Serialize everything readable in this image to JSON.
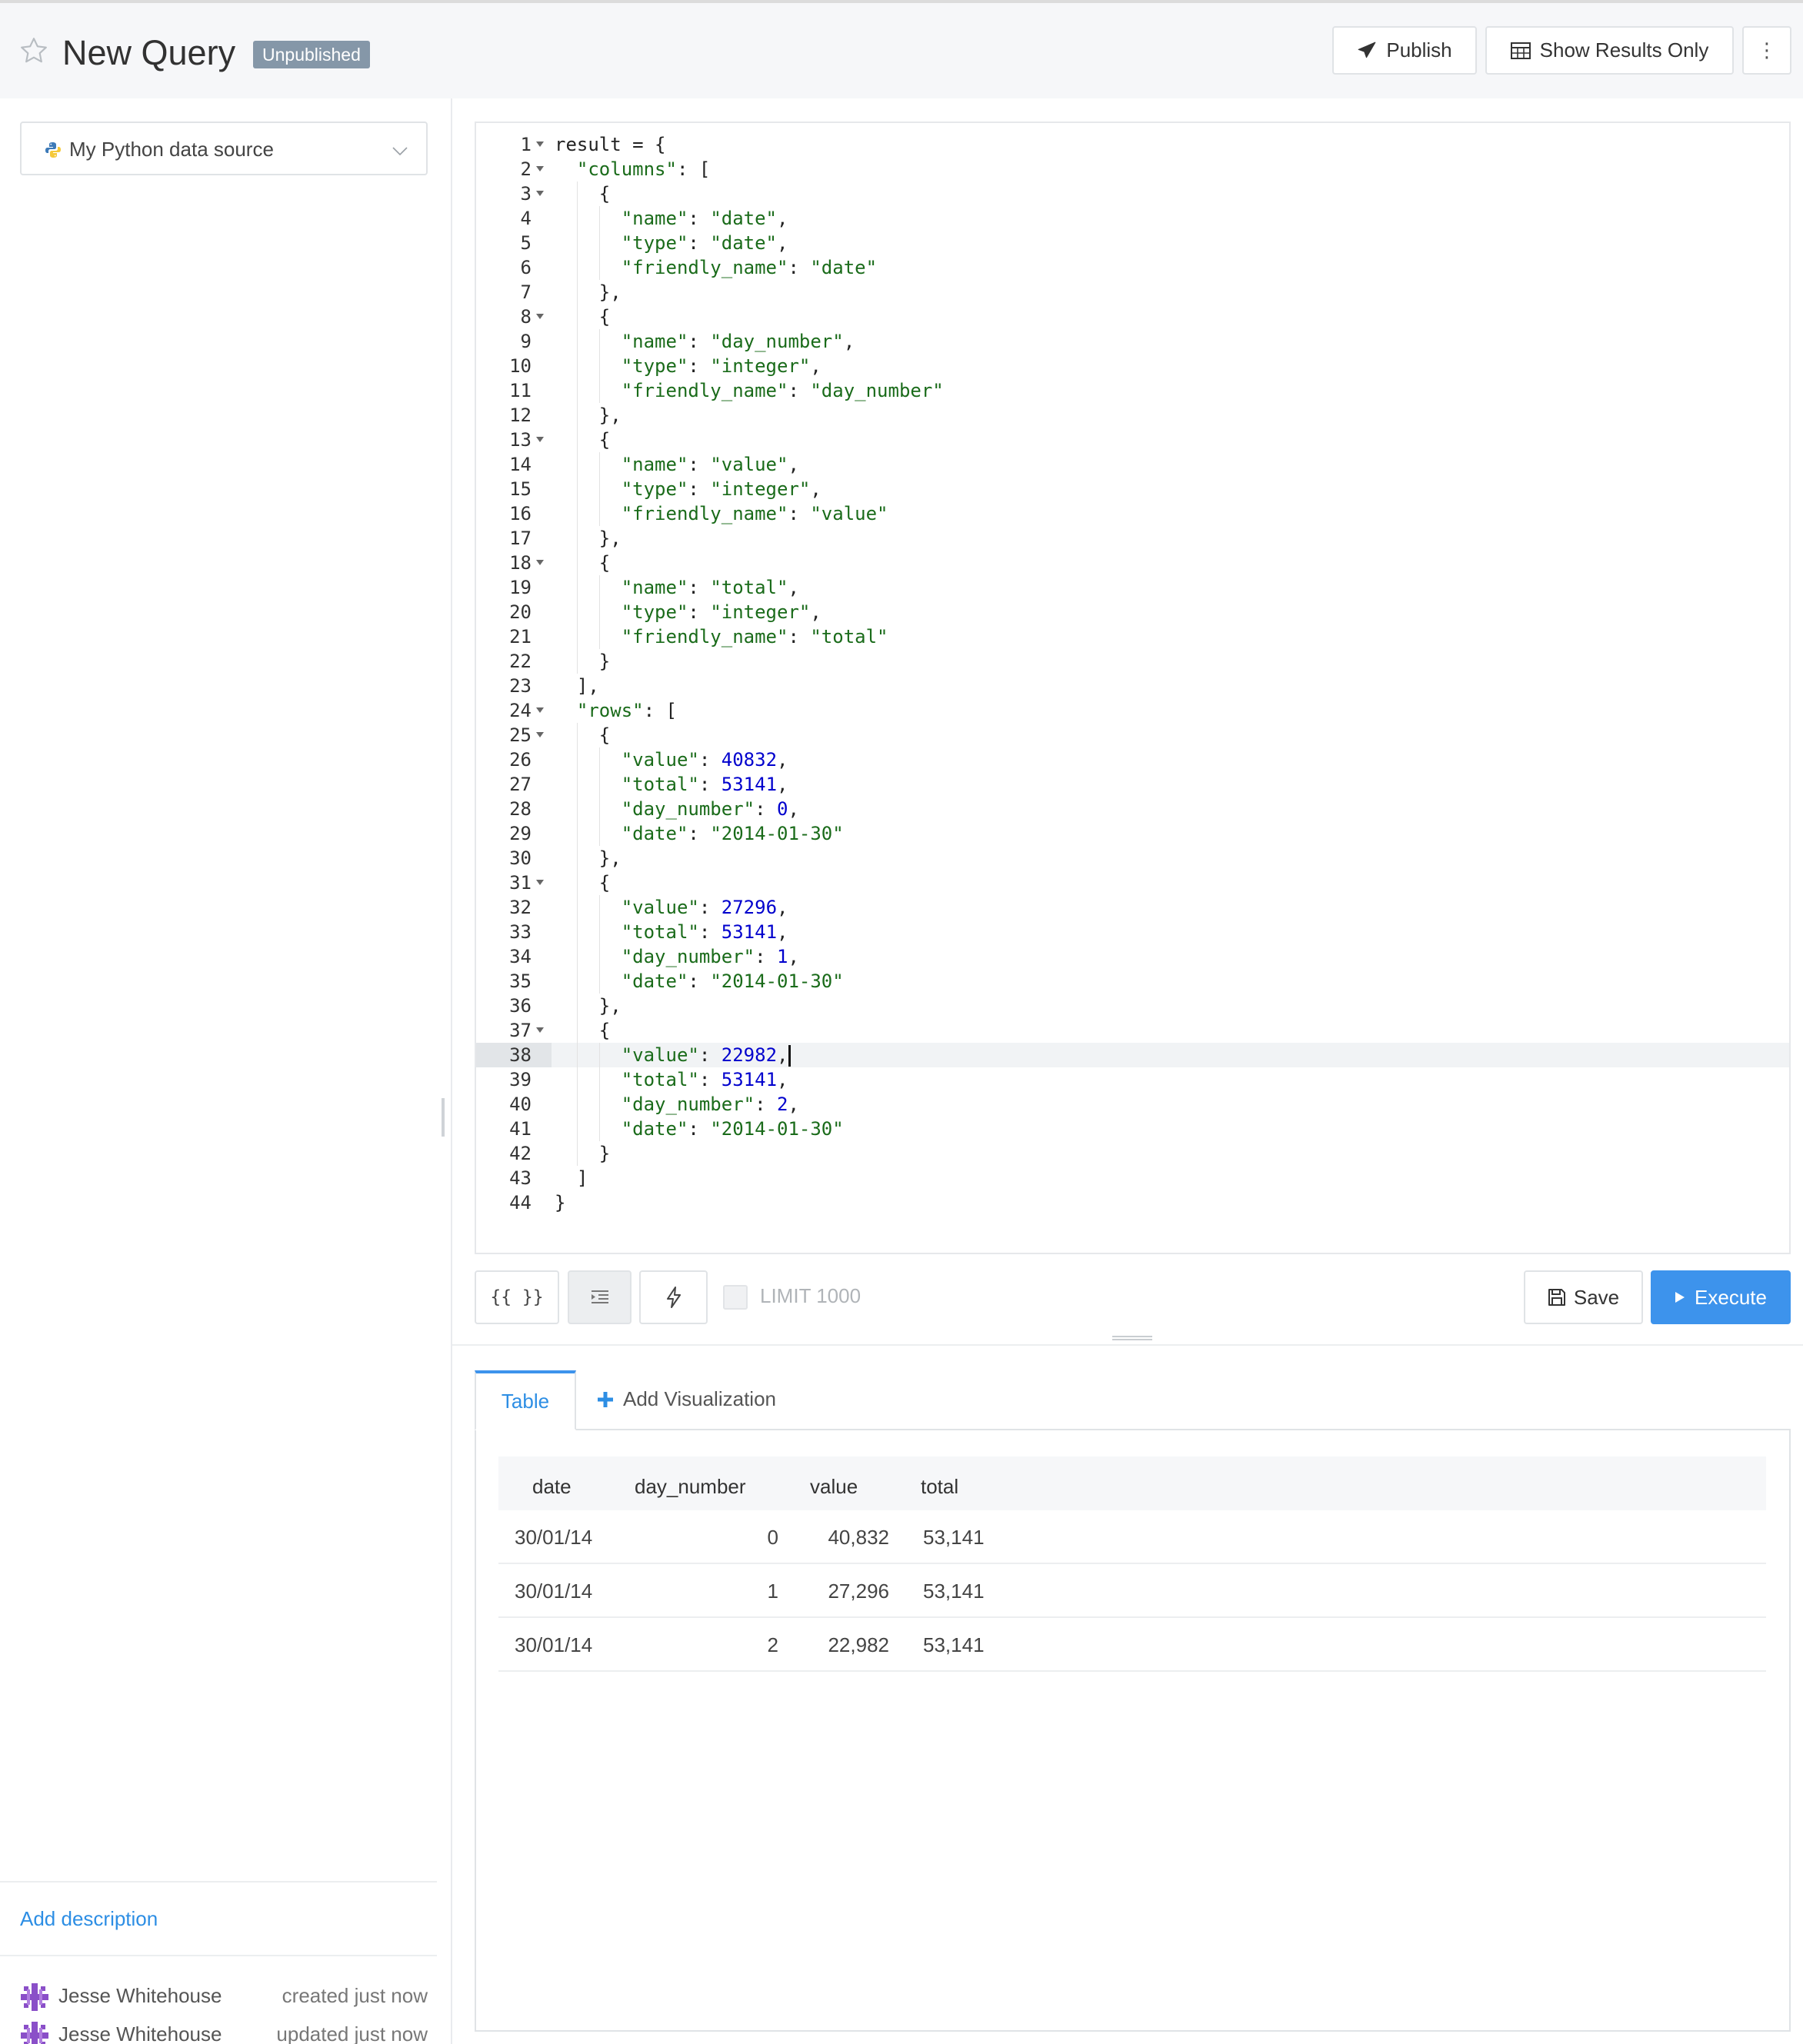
{
  "header": {
    "title": "New Query",
    "status_badge": "Unpublished",
    "publish_label": "Publish",
    "show_results_label": "Show Results Only",
    "more_label": "⋮"
  },
  "sidebar": {
    "data_source": "My Python data source",
    "add_description": "Add description",
    "users": [
      {
        "name": "Jesse Whitehouse",
        "status": "created just now"
      },
      {
        "name": "Jesse Whitehouse",
        "status": "updated just now"
      }
    ]
  },
  "editor": {
    "active_line": 38,
    "lines": [
      [
        [
          "p",
          "result = {"
        ]
      ],
      [
        [
          "p",
          "  "
        ],
        [
          "k",
          "\"columns\""
        ],
        [
          "p",
          ": ["
        ]
      ],
      [
        [
          "p",
          "    {"
        ]
      ],
      [
        [
          "p",
          "      "
        ],
        [
          "k",
          "\"name\""
        ],
        [
          "p",
          ": "
        ],
        [
          "s",
          "\"date\""
        ],
        [
          "p",
          ","
        ]
      ],
      [
        [
          "p",
          "      "
        ],
        [
          "k",
          "\"type\""
        ],
        [
          "p",
          ": "
        ],
        [
          "s",
          "\"date\""
        ],
        [
          "p",
          ","
        ]
      ],
      [
        [
          "p",
          "      "
        ],
        [
          "k",
          "\"friendly_name\""
        ],
        [
          "p",
          ": "
        ],
        [
          "s",
          "\"date\""
        ]
      ],
      [
        [
          "p",
          "    },"
        ]
      ],
      [
        [
          "p",
          "    {"
        ]
      ],
      [
        [
          "p",
          "      "
        ],
        [
          "k",
          "\"name\""
        ],
        [
          "p",
          ": "
        ],
        [
          "s",
          "\"day_number\""
        ],
        [
          "p",
          ","
        ]
      ],
      [
        [
          "p",
          "      "
        ],
        [
          "k",
          "\"type\""
        ],
        [
          "p",
          ": "
        ],
        [
          "s",
          "\"integer\""
        ],
        [
          "p",
          ","
        ]
      ],
      [
        [
          "p",
          "      "
        ],
        [
          "k",
          "\"friendly_name\""
        ],
        [
          "p",
          ": "
        ],
        [
          "s",
          "\"day_number\""
        ]
      ],
      [
        [
          "p",
          "    },"
        ]
      ],
      [
        [
          "p",
          "    {"
        ]
      ],
      [
        [
          "p",
          "      "
        ],
        [
          "k",
          "\"name\""
        ],
        [
          "p",
          ": "
        ],
        [
          "s",
          "\"value\""
        ],
        [
          "p",
          ","
        ]
      ],
      [
        [
          "p",
          "      "
        ],
        [
          "k",
          "\"type\""
        ],
        [
          "p",
          ": "
        ],
        [
          "s",
          "\"integer\""
        ],
        [
          "p",
          ","
        ]
      ],
      [
        [
          "p",
          "      "
        ],
        [
          "k",
          "\"friendly_name\""
        ],
        [
          "p",
          ": "
        ],
        [
          "s",
          "\"value\""
        ]
      ],
      [
        [
          "p",
          "    },"
        ]
      ],
      [
        [
          "p",
          "    {"
        ]
      ],
      [
        [
          "p",
          "      "
        ],
        [
          "k",
          "\"name\""
        ],
        [
          "p",
          ": "
        ],
        [
          "s",
          "\"total\""
        ],
        [
          "p",
          ","
        ]
      ],
      [
        [
          "p",
          "      "
        ],
        [
          "k",
          "\"type\""
        ],
        [
          "p",
          ": "
        ],
        [
          "s",
          "\"integer\""
        ],
        [
          "p",
          ","
        ]
      ],
      [
        [
          "p",
          "      "
        ],
        [
          "k",
          "\"friendly_name\""
        ],
        [
          "p",
          ": "
        ],
        [
          "s",
          "\"total\""
        ]
      ],
      [
        [
          "p",
          "    }"
        ]
      ],
      [
        [
          "p",
          "  ],"
        ]
      ],
      [
        [
          "p",
          "  "
        ],
        [
          "k",
          "\"rows\""
        ],
        [
          "p",
          ": ["
        ]
      ],
      [
        [
          "p",
          "    {"
        ]
      ],
      [
        [
          "p",
          "      "
        ],
        [
          "k",
          "\"value\""
        ],
        [
          "p",
          ": "
        ],
        [
          "n",
          "40832"
        ],
        [
          "p",
          ","
        ]
      ],
      [
        [
          "p",
          "      "
        ],
        [
          "k",
          "\"total\""
        ],
        [
          "p",
          ": "
        ],
        [
          "n",
          "53141"
        ],
        [
          "p",
          ","
        ]
      ],
      [
        [
          "p",
          "      "
        ],
        [
          "k",
          "\"day_number\""
        ],
        [
          "p",
          ": "
        ],
        [
          "n",
          "0"
        ],
        [
          "p",
          ","
        ]
      ],
      [
        [
          "p",
          "      "
        ],
        [
          "k",
          "\"date\""
        ],
        [
          "p",
          ": "
        ],
        [
          "s",
          "\"2014-01-30\""
        ]
      ],
      [
        [
          "p",
          "    },"
        ]
      ],
      [
        [
          "p",
          "    {"
        ]
      ],
      [
        [
          "p",
          "      "
        ],
        [
          "k",
          "\"value\""
        ],
        [
          "p",
          ": "
        ],
        [
          "n",
          "27296"
        ],
        [
          "p",
          ","
        ]
      ],
      [
        [
          "p",
          "      "
        ],
        [
          "k",
          "\"total\""
        ],
        [
          "p",
          ": "
        ],
        [
          "n",
          "53141"
        ],
        [
          "p",
          ","
        ]
      ],
      [
        [
          "p",
          "      "
        ],
        [
          "k",
          "\"day_number\""
        ],
        [
          "p",
          ": "
        ],
        [
          "n",
          "1"
        ],
        [
          "p",
          ","
        ]
      ],
      [
        [
          "p",
          "      "
        ],
        [
          "k",
          "\"date\""
        ],
        [
          "p",
          ": "
        ],
        [
          "s",
          "\"2014-01-30\""
        ]
      ],
      [
        [
          "p",
          "    },"
        ]
      ],
      [
        [
          "p",
          "    {"
        ]
      ],
      [
        [
          "p",
          "      "
        ],
        [
          "k",
          "\"value\""
        ],
        [
          "p",
          ": "
        ],
        [
          "n",
          "22982"
        ],
        [
          "p",
          ","
        ]
      ],
      [
        [
          "p",
          "      "
        ],
        [
          "k",
          "\"total\""
        ],
        [
          "p",
          ": "
        ],
        [
          "n",
          "53141"
        ],
        [
          "p",
          ","
        ]
      ],
      [
        [
          "p",
          "      "
        ],
        [
          "k",
          "\"day_number\""
        ],
        [
          "p",
          ": "
        ],
        [
          "n",
          "2"
        ],
        [
          "p",
          ","
        ]
      ],
      [
        [
          "p",
          "      "
        ],
        [
          "k",
          "\"date\""
        ],
        [
          "p",
          ": "
        ],
        [
          "s",
          "\"2014-01-30\""
        ]
      ],
      [
        [
          "p",
          "    }"
        ]
      ],
      [
        [
          "p",
          "  ]"
        ]
      ],
      [
        [
          "p",
          "}"
        ]
      ]
    ],
    "foldable_lines": [
      1,
      2,
      3,
      8,
      13,
      18,
      24,
      25,
      31,
      37
    ]
  },
  "toolbar": {
    "params_label": "{{ }}",
    "limit_label": "LIMIT 1000",
    "limit_checked": false,
    "save_label": "Save",
    "execute_label": "Execute"
  },
  "results": {
    "tabs": [
      {
        "label": "Table",
        "active": true
      },
      {
        "label": "Add Visualization",
        "active": false
      }
    ],
    "columns": [
      "date",
      "day_number",
      "value",
      "total"
    ],
    "rows": [
      [
        "30/01/14",
        "0",
        "40,832",
        "53,141"
      ],
      [
        "30/01/14",
        "1",
        "27,296",
        "53,141"
      ],
      [
        "30/01/14",
        "2",
        "22,982",
        "53,141"
      ]
    ]
  },
  "colors": {
    "accent": "#3d93ec",
    "badge": "#8597a8",
    "link": "#2d8ee4",
    "code_string": "#1a6b1a",
    "code_number": "#0000cd"
  },
  "icons": {
    "favorite": "star-outline-icon",
    "publish": "paper-plane-icon",
    "show_results": "table-grid-icon",
    "more": "vertical-ellipsis-icon",
    "data_source": "python-logo-icon",
    "format": "indent-icon",
    "autocomplete": "lightning-icon",
    "save": "floppy-disk-icon",
    "execute": "play-triangle-icon",
    "add": "plus-icon",
    "avatar": "identicon-avatar-icon"
  }
}
